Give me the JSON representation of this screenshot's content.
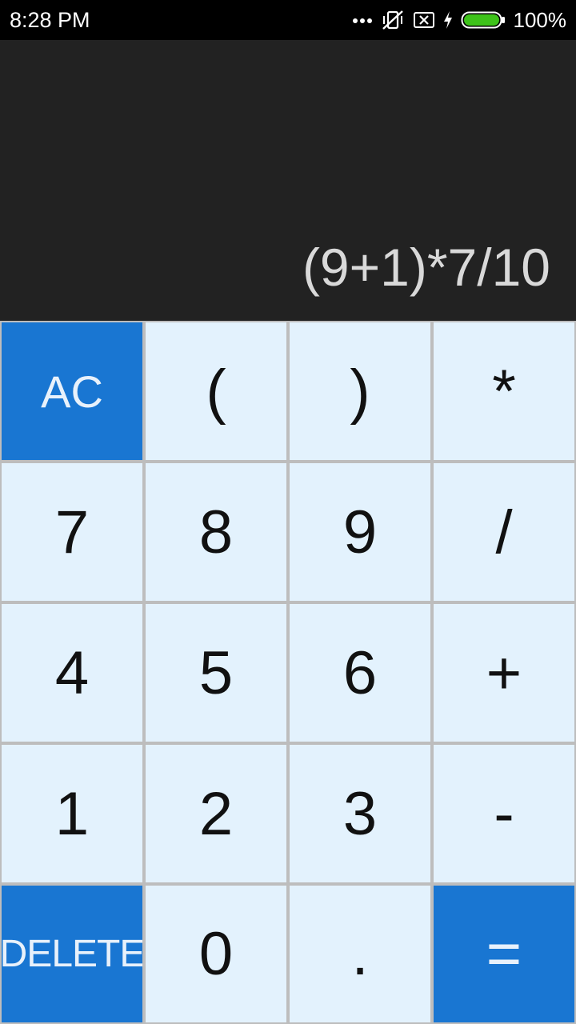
{
  "status_bar": {
    "time": "8:28 PM",
    "battery_percent": "100%",
    "icons": [
      "more-dots-icon",
      "vibrate-off-icon",
      "no-sim-icon",
      "charging-bolt-icon",
      "battery-icon"
    ]
  },
  "display": {
    "expression": "(9+1)*7/10"
  },
  "colors": {
    "accent": "#1976d2",
    "key_background": "#e3f2fd",
    "display_background": "#222222"
  },
  "keypad": {
    "rows": [
      [
        "AC",
        "(",
        ")",
        "*"
      ],
      [
        "7",
        "8",
        "9",
        "/"
      ],
      [
        "4",
        "5",
        "6",
        "+"
      ],
      [
        "1",
        "2",
        "3",
        "-"
      ],
      [
        "DELETE",
        "0",
        ".",
        "="
      ]
    ]
  }
}
